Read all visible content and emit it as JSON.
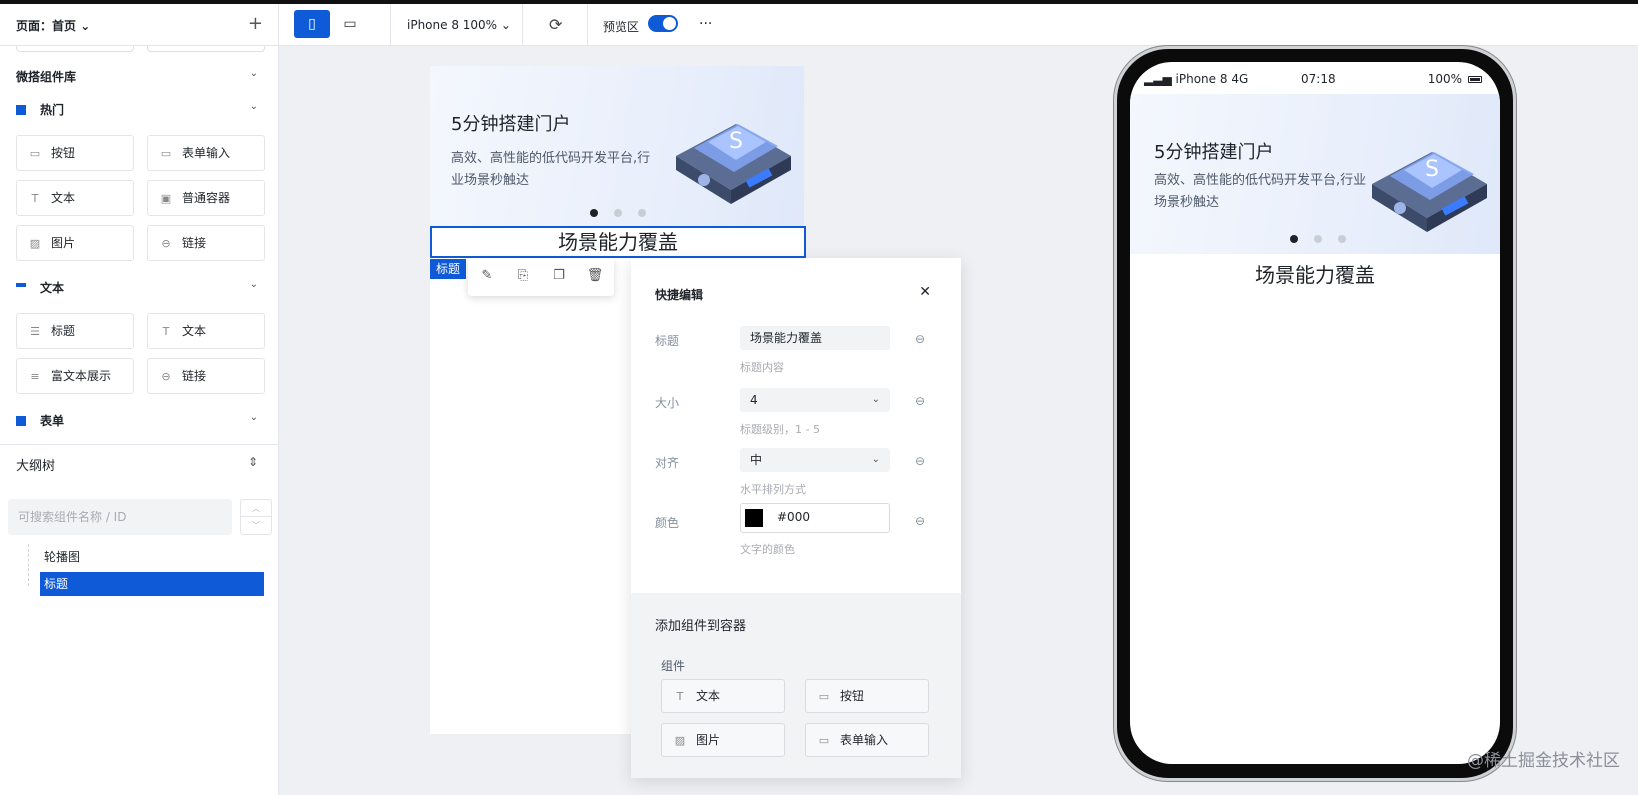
{
  "left_panel": {
    "page_selector": "页面：首页",
    "library_title": "微搭组件库",
    "categories": [
      {
        "name": "热门",
        "items": [
          "按钮",
          "表单输入",
          "文本",
          "普通容器",
          "图片",
          "链接"
        ]
      },
      {
        "name": "文本",
        "items": [
          "标题",
          "文本",
          "富文本展示",
          "链接"
        ]
      },
      {
        "name": "表单"
      }
    ],
    "outline_title": "大纲树",
    "search_placeholder": "可搜索组件名称 / ID",
    "tree": [
      "轮播图",
      "标题"
    ]
  },
  "toolbar": {
    "device": "iPhone 8 100%",
    "preview_label": "预览区",
    "preview_enabled": true,
    "more": "···"
  },
  "canvas": {
    "banner_title": "5分钟搭建门户",
    "banner_subtitle": "高效、高性能的低代码开发平台,行业场景秒触达",
    "heading": "场景能力覆盖",
    "selected_tag": "标题"
  },
  "quick_edit": {
    "title": "快捷编辑",
    "fields": [
      {
        "label": "标题",
        "value": "场景能力覆盖",
        "help": "标题内容"
      },
      {
        "label": "大小",
        "value": "4",
        "help": "标题级别，1 - 5"
      },
      {
        "label": "对齐",
        "value": "中",
        "help": "水平排列方式"
      },
      {
        "label": "颜色",
        "value": "#000",
        "help": "文字的颜色"
      }
    ],
    "add_title": "添加组件到容器",
    "group_label": "组件",
    "components": [
      "文本",
      "按钮",
      "图片",
      "表单输入"
    ]
  },
  "phone": {
    "carrier": "iPhone 8",
    "network": "4G",
    "time": "07:18",
    "battery": "100%"
  },
  "watermark": "@稀土掘金技术社区",
  "colors": {
    "accent": "#0f5bd7"
  }
}
